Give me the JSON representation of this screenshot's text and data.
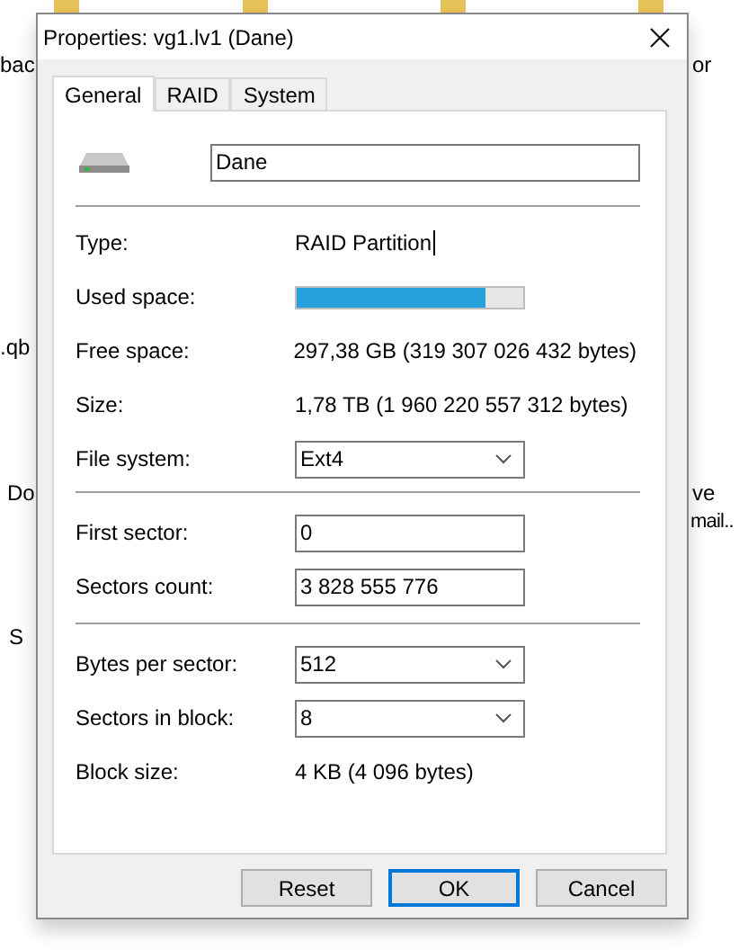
{
  "desktop": {
    "labels": [
      {
        "text": "bac"
      },
      {
        "text": "or"
      },
      {
        "text": ".qb"
      },
      {
        "text": "Do"
      },
      {
        "text": "ve"
      },
      {
        "text": "mail.."
      },
      {
        "text": "S"
      }
    ]
  },
  "window": {
    "title": "Properties: vg1.lv1 (Dane)"
  },
  "tabs": [
    {
      "label": "General",
      "selected": true
    },
    {
      "label": "RAID",
      "selected": false
    },
    {
      "label": "System",
      "selected": false
    }
  ],
  "name_field": {
    "value": "Dane"
  },
  "sections": [
    [
      {
        "kind": "text",
        "label": "Type:",
        "value": "RAID Partition",
        "cursor": true
      },
      {
        "kind": "bar",
        "label": "Used space:",
        "level": 0.83
      },
      {
        "kind": "text",
        "label": "Free space:",
        "value": "297,38 GB (319 307 026 432 bytes)",
        "cursor": false
      },
      {
        "kind": "text",
        "label": "Size:",
        "value": "1,78 TB (1 960 220 557 312 bytes)",
        "cursor": false
      },
      {
        "kind": "select",
        "label": "File system:",
        "value": "Ext4"
      }
    ],
    [
      {
        "kind": "input",
        "label": "First sector:",
        "value": "0"
      },
      {
        "kind": "input",
        "label": "Sectors count:",
        "value": "3 828 555 776"
      }
    ],
    [
      {
        "kind": "select",
        "label": "Bytes per sector:",
        "value": "512"
      },
      {
        "kind": "select",
        "label": "Sectors in block:",
        "value": "8"
      },
      {
        "kind": "text",
        "label": "Block size:",
        "value": "4 KB (4 096 bytes)",
        "cursor": false
      }
    ]
  ],
  "buttons": [
    {
      "label": "Reset",
      "focused": false
    },
    {
      "label": "OK",
      "focused": true
    },
    {
      "label": "Cancel",
      "focused": false
    }
  ]
}
